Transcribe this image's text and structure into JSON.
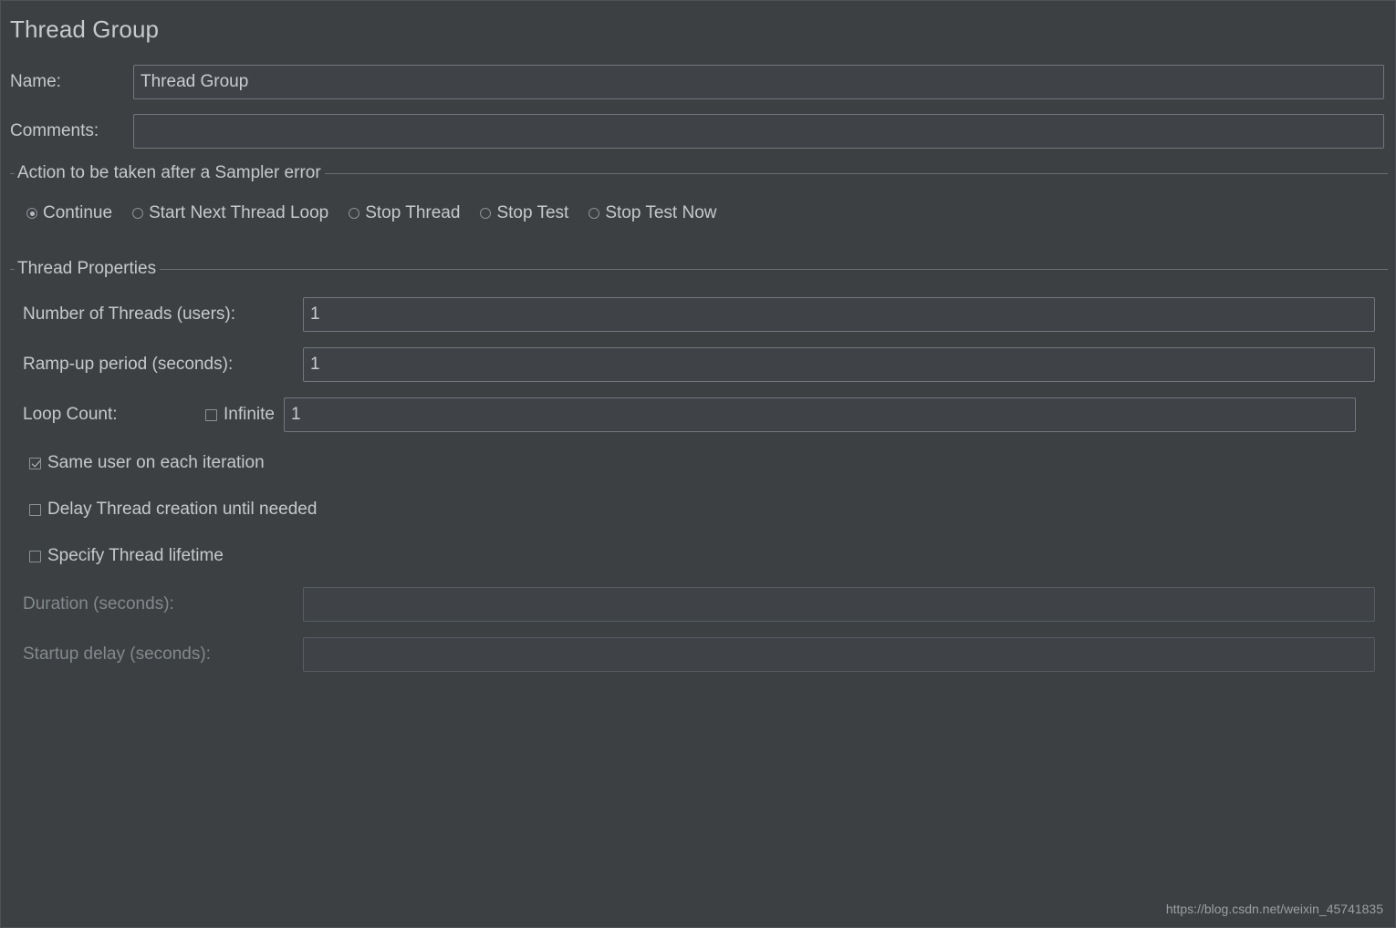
{
  "window": {
    "title": "Thread Group",
    "watermark": "https://blog.csdn.net/weixin_45741835",
    "colors": {
      "background": "#3c4043",
      "field_background": "#3f4347",
      "field_border": "#72777b",
      "text": "#c6c9cc",
      "disabled_text": "#83888c",
      "separator": "#6a6f73"
    }
  },
  "name": {
    "label": "Name:",
    "value": "Thread Group",
    "placeholder": ""
  },
  "comments": {
    "label": "Comments:",
    "value": "",
    "placeholder": ""
  },
  "sampler_error": {
    "group_title": "Action to be taken after a Sampler error",
    "selected": "Continue",
    "options": [
      {
        "label": "Continue",
        "checked": true
      },
      {
        "label": "Start Next Thread Loop",
        "checked": false
      },
      {
        "label": "Stop Thread",
        "checked": false
      },
      {
        "label": "Stop Test",
        "checked": false
      },
      {
        "label": "Stop Test Now",
        "checked": false
      }
    ]
  },
  "thread_properties": {
    "group_title": "Thread Properties",
    "number_of_threads": {
      "label": "Number of Threads (users):",
      "value": "1",
      "placeholder": ""
    },
    "ramp_up": {
      "label": "Ramp-up period (seconds):",
      "value": "1",
      "placeholder": ""
    },
    "loop_count": {
      "label": "Loop Count:",
      "infinite_label": "Infinite",
      "infinite_checked": false,
      "value": "1",
      "placeholder": ""
    },
    "same_user": {
      "label": "Same user on each iteration",
      "checked": true
    },
    "delay_thread_creation": {
      "label": "Delay Thread creation until needed",
      "checked": false
    },
    "specify_lifetime": {
      "label": "Specify Thread lifetime",
      "checked": false
    },
    "duration": {
      "label": "Duration (seconds):",
      "value": "",
      "placeholder": "",
      "disabled": true
    },
    "startup_delay": {
      "label": "Startup delay (seconds):",
      "value": "",
      "placeholder": "",
      "disabled": true
    }
  }
}
